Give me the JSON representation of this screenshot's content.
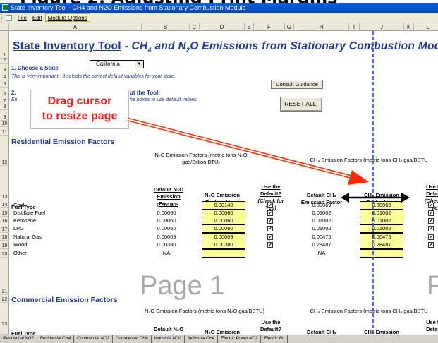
{
  "caption": "Figure 2. Adjusting Print Margins",
  "window": {
    "title": "State Inventory Tool - CH4 and N2O Emissions from Stationary Combustion Module"
  },
  "menu": {
    "file": "File",
    "edit": "Edit",
    "module_options": "Module Options"
  },
  "columns": [
    "A",
    "B",
    "C",
    "D",
    "E",
    "F",
    "G",
    "H",
    "I",
    "J",
    "K",
    "L"
  ],
  "rows": [
    "1",
    "2",
    "3",
    "4",
    "5",
    "6",
    "7",
    "8",
    "9",
    "10",
    "11",
    "12",
    "13",
    "14",
    "15",
    "16",
    "17",
    "18",
    "19",
    "20",
    "21",
    "22",
    "23"
  ],
  "sheet": {
    "title_prefix": "State Inventory Tool",
    "title_dash": "-",
    "title_ch": "CH",
    "title_4": "4",
    "title_and": "and N",
    "title_2": "2",
    "title_rest": "O Emissions from Stationary Combustion Modul",
    "step1_label": "1. Choose a State",
    "state_value": "California",
    "step1_note": "This is very important - it selects the correct default variables for your state.",
    "step2_prefix": "2.",
    "step2_label_tail": "ut the Tool.",
    "step2_note_prefix": "En",
    "step2_note_tail": "he boxes to use default values",
    "consult_button": "Consult Guidance",
    "reset_button": "RESET ALL!",
    "drag_line1": "Drag cursor",
    "drag_line2": "to resize page",
    "residential_title": "Residential Emission Factors",
    "commercial_title": "Commercial Emission Factors",
    "n2o_header_res": "N₂O Emission Factors (metric tons N₂O gas/Billion BTU)",
    "ch4_header_res": "CH₄ Emission Factors (metric tons CH₄ gas/BBTU",
    "n2o_header_com": "N₂O Emission Factors (metric tons N₂O gas/BBTU)",
    "ch4_header_com": "CH₄ Emission Factors (metric tons CH₄ gas/BBTU",
    "col_fuel_type": "Fuel Type",
    "col_default_n2o": "Default N₂O Emission Factors",
    "col_n2o_used": "N₂O Emission Factors Used",
    "col_use_default": "Use the Default?",
    "col_check": "(Check for Yes)",
    "col_default_ch4": "Default CH₄ Emission Factor",
    "col_ch4_used": "CH₄ Emission Factor Used",
    "col_use_default_cut": "Use th Defaul",
    "col_check_cut": "(Check Yes)",
    "com_fuel_type": "Fuel Type",
    "com_default_n2o": "Default N₂O Emission",
    "com_n2o_used": "N₂O Emission",
    "com_use_default": "Use the Default?",
    "com_default_ch4": "Default CH₄",
    "com_ch4_used": "CH₄ Emission",
    "com_use_default_cut": "Use th Defaul",
    "page1": "Page 1",
    "page2": "P",
    "checkmark": "✔"
  },
  "residential_rows": [
    {
      "fuel": "Coal",
      "n2o_default": "0.00140",
      "n2o_used": "0.00140",
      "ch4_default": "0.30069",
      "ch4_used": "0.30069"
    },
    {
      "fuel": "Distillate Fuel",
      "n2o_default": "0.00060",
      "n2o_used": "0.00060",
      "ch4_default": "0.01002",
      "ch4_used": "0.01002"
    },
    {
      "fuel": "Kerosene",
      "n2o_default": "0.00060",
      "n2o_used": "0.00060",
      "ch4_default": "0.01002",
      "ch4_used": "0.01002"
    },
    {
      "fuel": "LPG",
      "n2o_default": "0.00060",
      "n2o_used": "0.00060",
      "ch4_default": "0.01002",
      "ch4_used": "0.01002"
    },
    {
      "fuel": "Natural Gas",
      "n2o_default": "0.00009",
      "n2o_used": "0.00009",
      "ch4_default": "0.00475",
      "ch4_used": "0.00475"
    },
    {
      "fuel": "Wood",
      "n2o_default": "0.00380",
      "n2o_used": "0.00380",
      "ch4_default": "0.28487",
      "ch4_used": "0.28487"
    },
    {
      "fuel": "Other",
      "n2o_default": "NA",
      "n2o_used": "",
      "ch4_default": "NA",
      "ch4_used": ""
    }
  ],
  "sheet_tabs": [
    "Residential NO2",
    "Residential CH4",
    "Commercial NO2",
    "Commercial CH4",
    "Industrial NO2",
    "Industrial CH4",
    "Electric Power NO2",
    "Electric Po"
  ],
  "colors": {
    "title_blue": "#1f3a8a",
    "input_yellow": "#ffff99",
    "annotation_red": "#ff1a1a",
    "page_break_blue": "#1a3fcf"
  }
}
